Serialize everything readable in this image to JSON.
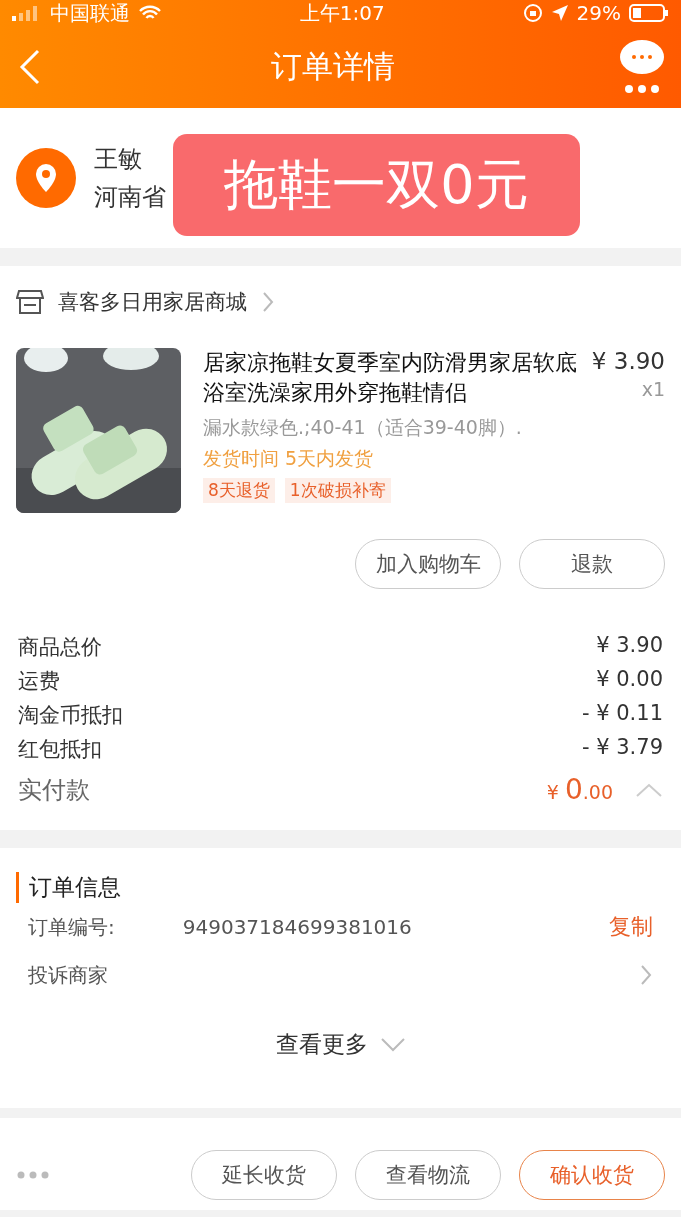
{
  "status_bar": {
    "carrier": "中国联通",
    "time": "上午1:07",
    "battery": "29%"
  },
  "nav": {
    "title": "订单详情"
  },
  "address": {
    "name": "王敏",
    "address": "河南省"
  },
  "overlay_banner": {
    "text": "拖鞋一双0元"
  },
  "shop": {
    "name": "喜客多日用家居商城"
  },
  "item": {
    "picture": {
      "kind": "picture"
    },
    "title": "居家凉拖鞋女夏季室内防滑男家居软底浴室洗澡家用外穿拖鞋情侣",
    "price": "¥ 3.90",
    "quantity": "x1",
    "spec": "漏水款绿色.;40-41（适合39-40脚）.",
    "shipping": "发货时间 5天内发货",
    "tags": [
      "8天退货",
      "1次破损补寄"
    ],
    "buttons": [
      {
        "label": "加入购物车"
      },
      {
        "label": "退款"
      }
    ]
  },
  "price_rows": [
    {
      "label": "商品总价",
      "value": "¥ 3.90"
    },
    {
      "label": "运费",
      "value": "¥ 0.00"
    },
    {
      "label": "淘金币抵扣",
      "value": "- ¥ 0.11"
    },
    {
      "label": "红包抵扣",
      "value": "- ¥ 3.79"
    }
  ],
  "paid": {
    "label": "实付款",
    "currency": "¥",
    "integer": "0",
    "decimal": ".00",
    "expanded": true
  },
  "order_info": {
    "title": "订单信息",
    "rows": [
      {
        "kind": "copy",
        "label": "订单编号:",
        "value": "949037184699381016",
        "action": "复制"
      },
      {
        "kind": "link",
        "label": "投诉商家"
      }
    ],
    "more": "查看更多"
  },
  "bottom_bar": {
    "buttons": [
      {
        "label": "延长收货",
        "primary": false
      },
      {
        "label": "查看物流",
        "primary": false
      },
      {
        "label": "确认收货",
        "primary": true
      }
    ]
  }
}
